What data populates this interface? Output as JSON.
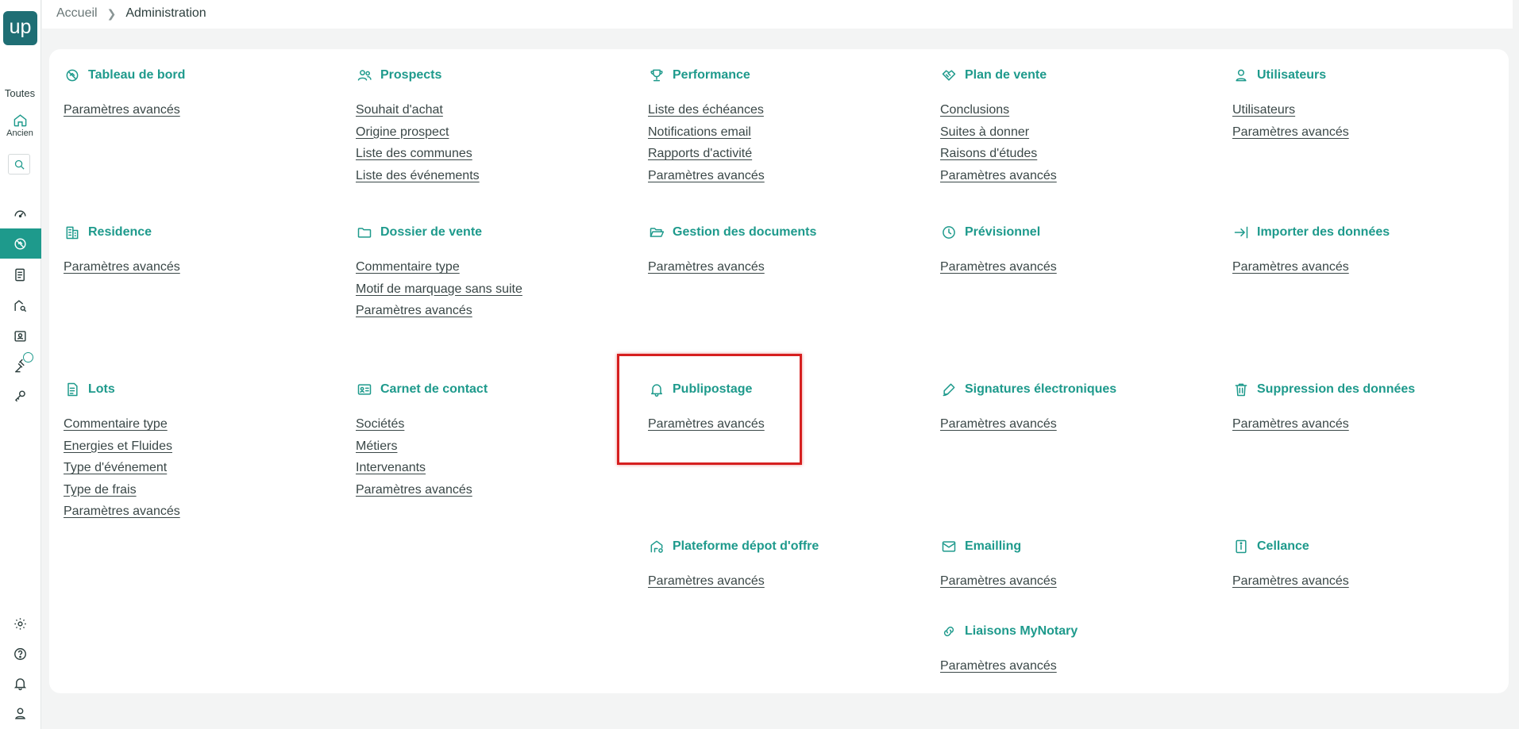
{
  "app": {
    "logo_text": "up",
    "brand_color": "#1f6e74",
    "accent_color": "#1e9a8c"
  },
  "sidebar": {
    "scope_label": "Toutes",
    "home_label": "Ancien",
    "icons": [
      "dashboard-icon",
      "admin-icon",
      "document-list-icon",
      "property-search-icon",
      "contacts-card-icon",
      "gavel-icon",
      "keys-icon",
      "settings-icon",
      "help-icon",
      "bell-icon",
      "user-icon"
    ]
  },
  "breadcrumb": {
    "home": "Accueil",
    "current": "Administration"
  },
  "sections": [
    {
      "id": "tableau-de-bord",
      "title": "Tableau de bord",
      "icon": "dashboard-icon",
      "links": [
        "Paramètres avancés"
      ]
    },
    {
      "id": "prospects",
      "title": "Prospects",
      "icon": "users-icon",
      "links": [
        "Souhait d'achat",
        "Origine prospect",
        "Liste des communes",
        "Liste des événements"
      ]
    },
    {
      "id": "performance",
      "title": "Performance",
      "icon": "trophy-icon",
      "links": [
        "Liste des échéances",
        "Notifications email",
        "Rapports d'activité",
        "Paramètres avancés"
      ]
    },
    {
      "id": "plan-de-vente",
      "title": "Plan de vente",
      "icon": "handshake-icon",
      "links": [
        "Conclusions",
        "Suites à donner",
        "Raisons d'études",
        "Paramètres avancés"
      ]
    },
    {
      "id": "utilisateurs",
      "title": "Utilisateurs",
      "icon": "user-icon",
      "links": [
        "Utilisateurs",
        "Paramètres avancés"
      ]
    },
    {
      "id": "residence",
      "title": "Residence",
      "icon": "building-icon",
      "links": [
        "Paramètres avancés"
      ]
    },
    {
      "id": "dossier-de-vente",
      "title": "Dossier de vente",
      "icon": "folder-icon",
      "links": [
        "Commentaire type",
        "Motif de marquage sans suite",
        "Paramètres avancés"
      ]
    },
    {
      "id": "gestion-des-documents",
      "title": "Gestion des documents",
      "icon": "folder-open-icon",
      "links": [
        "Paramètres avancés"
      ]
    },
    {
      "id": "previsionnel",
      "title": "Prévisionnel",
      "icon": "clock-icon",
      "links": [
        "Paramètres avancés"
      ]
    },
    {
      "id": "importer-des-donnees",
      "title": "Importer des données",
      "icon": "import-icon",
      "links": [
        "Paramètres avancés"
      ]
    },
    {
      "id": "lots",
      "title": "Lots",
      "icon": "document-icon",
      "links": [
        "Commentaire type",
        "Energies et Fluides",
        "Type d'événement",
        "Type de frais",
        "Paramètres avancés"
      ]
    },
    {
      "id": "carnet-de-contact",
      "title": "Carnet de contact",
      "icon": "contact-card-icon",
      "links": [
        "Sociétés",
        "Métiers",
        "Intervenants",
        "Paramètres avancés"
      ]
    },
    {
      "id": "publipostage",
      "title": "Publipostage",
      "icon": "bell-icon",
      "links": [
        "Paramètres avancés"
      ]
    },
    {
      "id": "signatures-electroniques",
      "title": "Signatures électroniques",
      "icon": "pen-icon",
      "links": [
        "Paramètres avancés"
      ]
    },
    {
      "id": "suppression-des-donnees",
      "title": "Suppression des données",
      "icon": "trash-icon",
      "links": [
        "Paramètres avancés"
      ]
    },
    {
      "id": "plateforme-depot-offre",
      "title": "Plateforme dépot d'offre",
      "icon": "house-offer-icon",
      "links": [
        "Paramètres avancés"
      ]
    },
    {
      "id": "emailling",
      "title": "Emailling",
      "icon": "mail-icon",
      "links": [
        "Paramètres avancés"
      ]
    },
    {
      "id": "cellance",
      "title": "Cellance",
      "icon": "info-icon",
      "links": [
        "Paramètres avancés"
      ]
    },
    {
      "id": "liaisons-mynotary",
      "title": "Liaisons MyNotary",
      "icon": "link-icon",
      "links": [
        "Paramètres avancés"
      ]
    }
  ],
  "highlight": {
    "section": "publipostage",
    "color": "#d61f1f"
  }
}
